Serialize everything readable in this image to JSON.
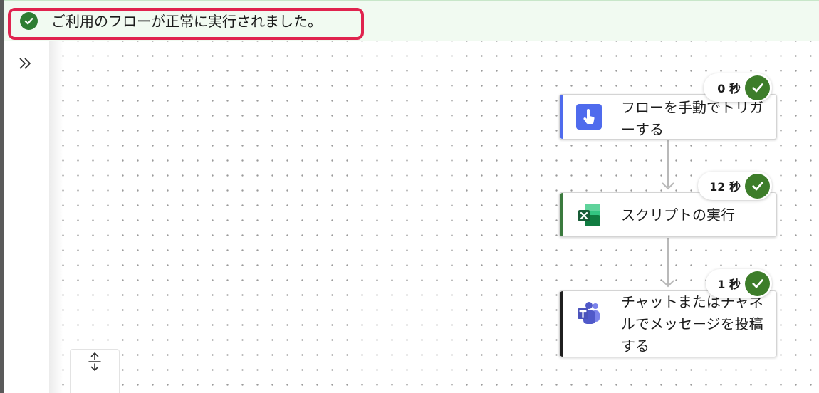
{
  "banner": {
    "icon": "check-circle-icon",
    "status_color": "#2e7d32",
    "message": "ご利用のフローが正常に実行されました。"
  },
  "sidebar": {
    "expand_icon": "double-chevron-right-icon"
  },
  "canvas": {
    "fit_view_icon": "collapse-vertical-arrows-icon"
  },
  "steps": [
    {
      "label": "フローを手動でトリガーする",
      "duration": "0 秒",
      "icon": "touch-trigger-icon",
      "accent_color": "#4f6bed",
      "status": "succeeded"
    },
    {
      "label": "スクリプトの実行",
      "duration": "12 秒",
      "icon": "excel-icon",
      "accent_color": "#3b7a3e",
      "status": "succeeded"
    },
    {
      "label": "チャットまたはチャネルでメッセージを投稿する",
      "duration": "1 秒",
      "icon": "teams-icon",
      "accent_color": "#1f1f1f",
      "status": "succeeded"
    }
  ]
}
